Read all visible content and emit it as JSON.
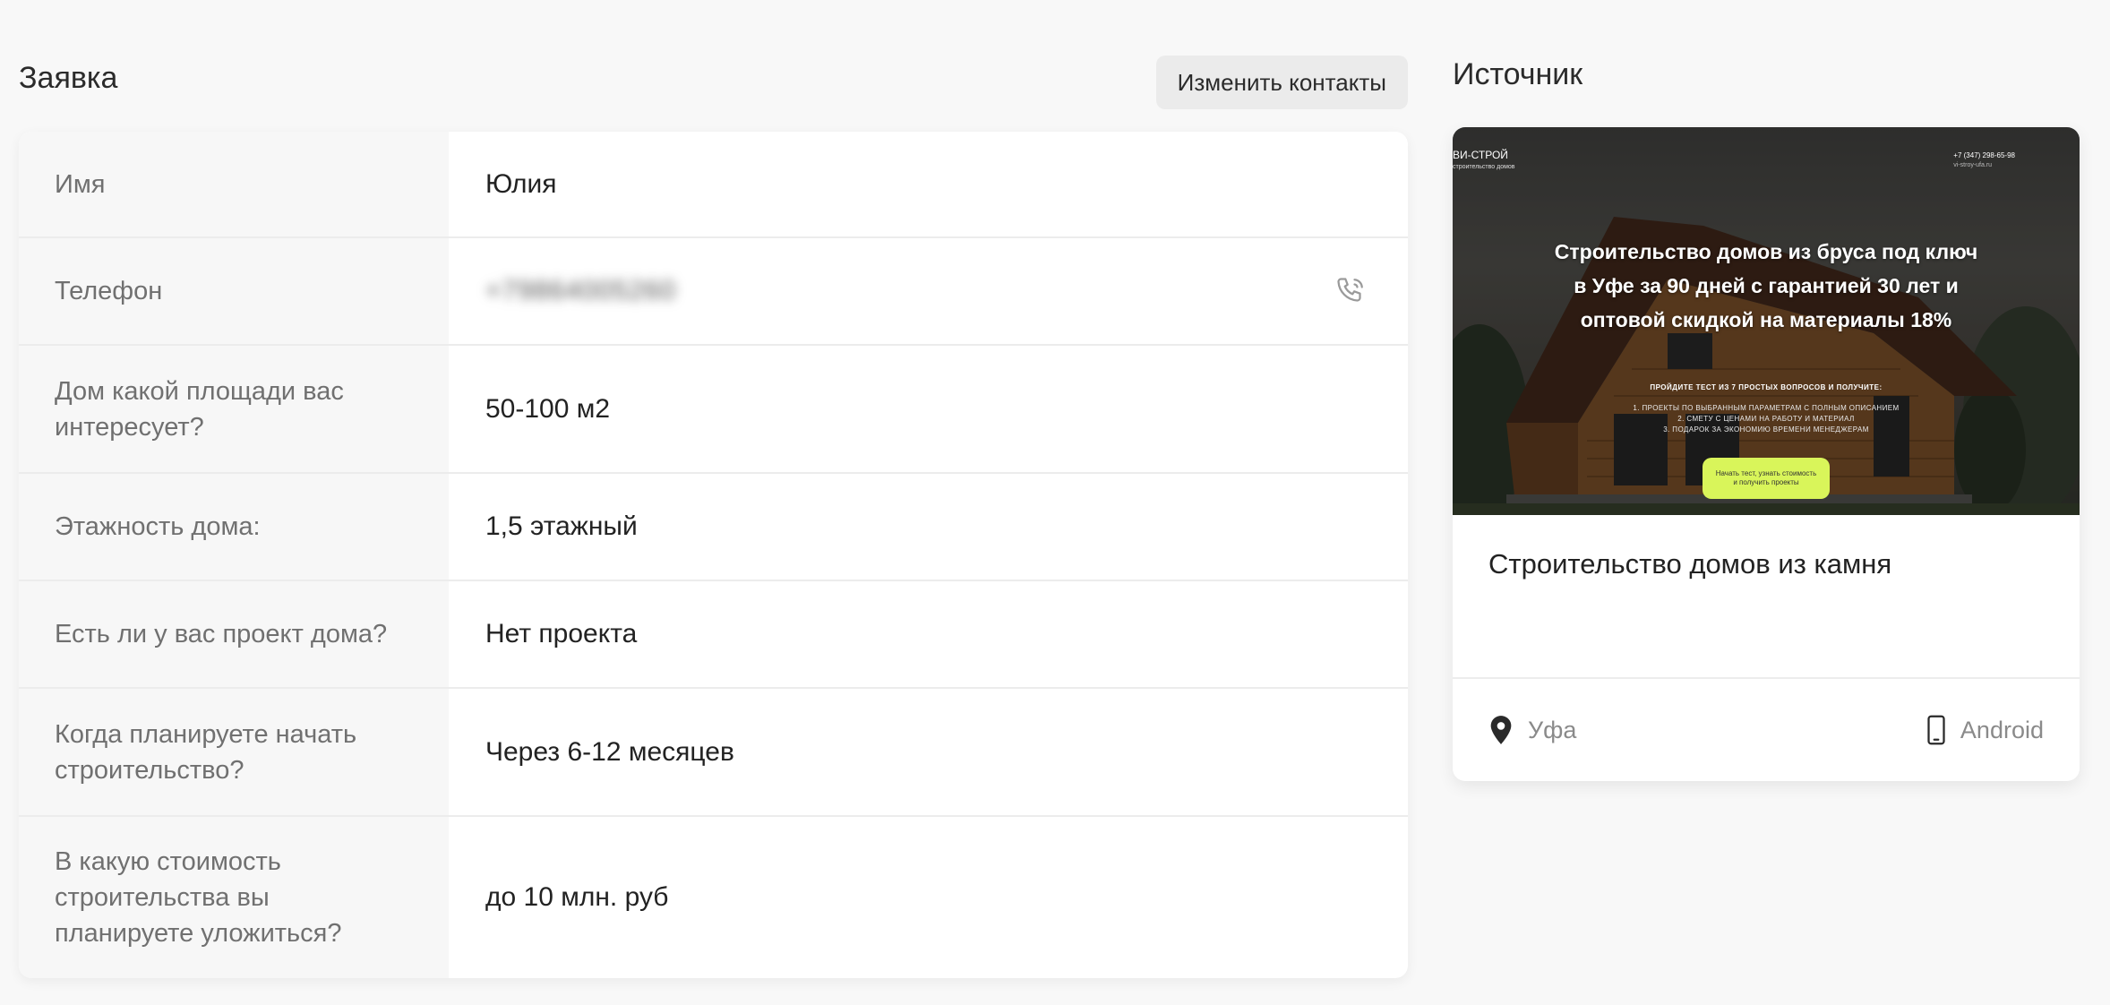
{
  "request": {
    "title": "Заявка",
    "edit_button": "Изменить контакты",
    "rows": [
      {
        "label": "Имя",
        "value": "Юлия"
      },
      {
        "label": "Телефон",
        "value": "+79864005260"
      },
      {
        "label": "Дом какой площади вас интересует?",
        "value": "50-100 м2"
      },
      {
        "label": "Этажность дома:",
        "value": "1,5 этажный"
      },
      {
        "label": "Есть ли у вас проект дома?",
        "value": "Нет проекта"
      },
      {
        "label": "Когда планируете начать строительство?",
        "value": "Через 6-12 месяцев"
      },
      {
        "label": "В какую стоимость строительства вы планируете уложиться?",
        "value": "до 10 млн. руб"
      }
    ],
    "phone_icon": "phone-call-icon"
  },
  "source": {
    "title": "Источник",
    "preview": {
      "logo": "ВИ-СТРОЙ",
      "logo_sub": "строительство домов",
      "phone": "+7 (347) 298-65-98",
      "phone_sub": "vi-stroy-ufa.ru",
      "headline": "Строительство домов из бруса под ключ в Уфе за 90 дней с гарантией 30 лет и оптовой скидкой на материалы 18%",
      "subhead": "ПРОЙДИТЕ ТЕСТ ИЗ 7 ПРОСТЫХ ВОПРОСОВ И ПОЛУЧИТЕ:",
      "list": [
        "1. ПРОЕКТЫ ПО ВЫБРАННЫМ ПАРАМЕТРАМ С ПОЛНЫМ ОПИСАНИЕМ",
        "2. СМЕТУ С ЦЕНАМИ НА РАБОТУ И МАТЕРИАЛ",
        "3. ПОДАРОК ЗА ЭКОНОМИЮ ВРЕМЕНИ МЕНЕДЖЕРАМ"
      ],
      "cta": "Начать тест, узнать стоимость и получить проекты"
    },
    "card_title": "Строительство домов из камня",
    "city": "Уфа",
    "platform": "Android",
    "icons": {
      "location": "location-pin-icon",
      "device": "smartphone-icon"
    }
  },
  "colors": {
    "page_bg": "#f8f8f8",
    "label_bg": "#f7f7f7",
    "button_bg": "#ebebeb",
    "cta": "#d9f55a"
  }
}
